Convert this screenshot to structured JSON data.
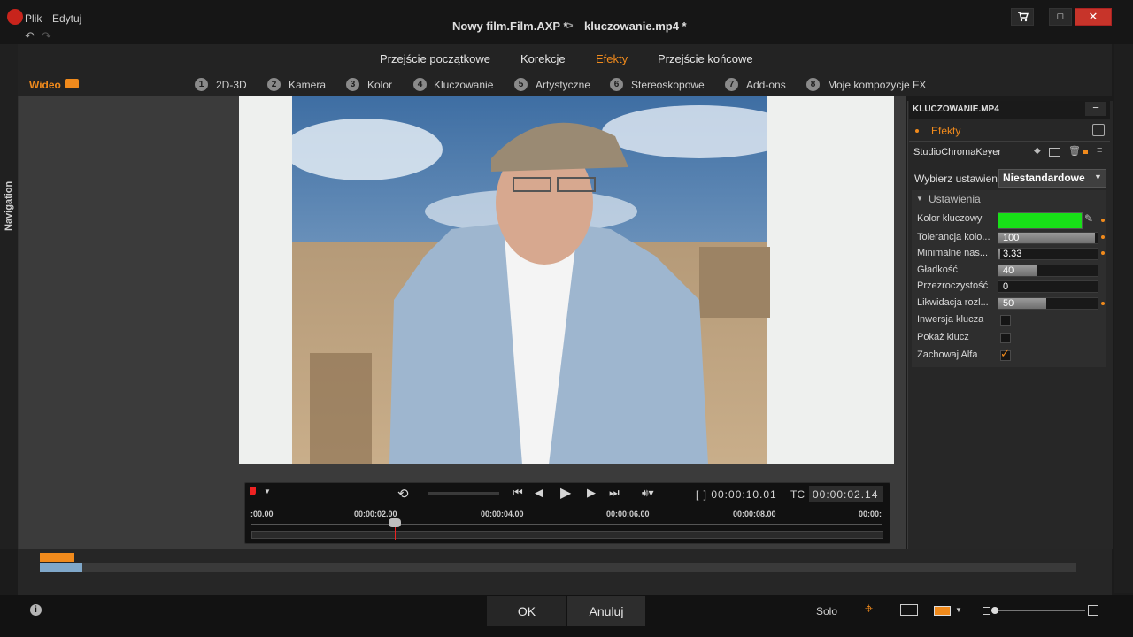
{
  "window": {
    "menu": [
      "Plik",
      "Edytuj"
    ],
    "title_project": "Nowy film.Film.AXP *",
    "title_separator": ">",
    "title_clip": "kluczowanie.mp4 *",
    "buttons": {
      "cart": "cart-icon",
      "maximize": "□",
      "close": "✕"
    }
  },
  "top_tabs": [
    {
      "label": "Przejście początkowe"
    },
    {
      "label": "Korekcje"
    },
    {
      "label": "Efekty"
    },
    {
      "label": "Przejście końcowe"
    }
  ],
  "active_tab": "Efekty",
  "media_type_label": "Wideo",
  "categories": [
    {
      "num": "1",
      "label": "2D-3D"
    },
    {
      "num": "2",
      "label": "Kamera"
    },
    {
      "num": "3",
      "label": "Kolor"
    },
    {
      "num": "4",
      "label": "Kluczowanie"
    },
    {
      "num": "5",
      "label": "Artystyczne"
    },
    {
      "num": "6",
      "label": "Stereoskopowe"
    },
    {
      "num": "7",
      "label": "Add-ons"
    },
    {
      "num": "8",
      "label": "Moje kompozycje FX"
    }
  ],
  "nav_label": "Navigation",
  "player": {
    "duration_label": "[ ] 00:00:10.01",
    "tc_label": "TC",
    "timecode": "00:00:02.14",
    "ticks": [
      ":00.00",
      "00:00:02.00",
      "00:00:04.00",
      "00:00:06.00",
      "00:00:08.00",
      "00:00:"
    ],
    "playhead_fraction": 0.228
  },
  "panel": {
    "title": "KLUCZOWANIE.MP4",
    "collapse": "−",
    "section": "Efekty",
    "effect_name": "StudioChromaKeyer",
    "preset_label": "Wybierz ustawien",
    "preset_value": "Niestandardowe",
    "settings_header": "Ustawienia",
    "key_color_label": "Kolor kluczowy",
    "key_color": "#18e018",
    "sliders": [
      {
        "label": "Tolerancja kolo...",
        "value": "100",
        "fraction": 1.0
      },
      {
        "label": "Minimalne nas...",
        "value": "3.33",
        "fraction": 0.03
      },
      {
        "label": "Gładkość",
        "value": "40",
        "fraction": 0.4
      },
      {
        "label": "Przezroczystość",
        "value": "0",
        "fraction": 0.0
      },
      {
        "label": "Likwidacja rozl...",
        "value": "50",
        "fraction": 0.5
      }
    ],
    "checkboxes": [
      {
        "label": "Inwersja klucza",
        "checked": false
      },
      {
        "label": "Pokaż klucz",
        "checked": false
      },
      {
        "label": "Zachowaj Alfa",
        "checked": true
      }
    ]
  },
  "footer": {
    "ok": "OK",
    "cancel": "Anuluj",
    "solo": "Solo",
    "info": "i"
  },
  "colors": {
    "accent": "#f08a1c",
    "close_red": "#c7342a"
  }
}
